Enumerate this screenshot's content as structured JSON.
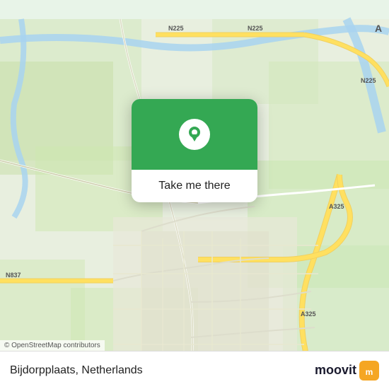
{
  "map": {
    "attribution": "© OpenStreetMap contributors",
    "center_lat": 51.97,
    "center_lon": 5.91
  },
  "card": {
    "button_label": "Take me there"
  },
  "info_bar": {
    "location_name": "Bijdorpplaats, Netherlands",
    "logo_text": "moovit"
  },
  "road_labels": {
    "n225_top": "N225",
    "n225_right": "N225",
    "n837": "N837",
    "a325_right": "A325",
    "a325_bottom": "A325"
  },
  "colors": {
    "green_accent": "#34a853",
    "road_yellow": "#f5d76e",
    "water_blue": "#b0d4f1",
    "map_bg": "#e8f4e8",
    "white": "#ffffff"
  }
}
